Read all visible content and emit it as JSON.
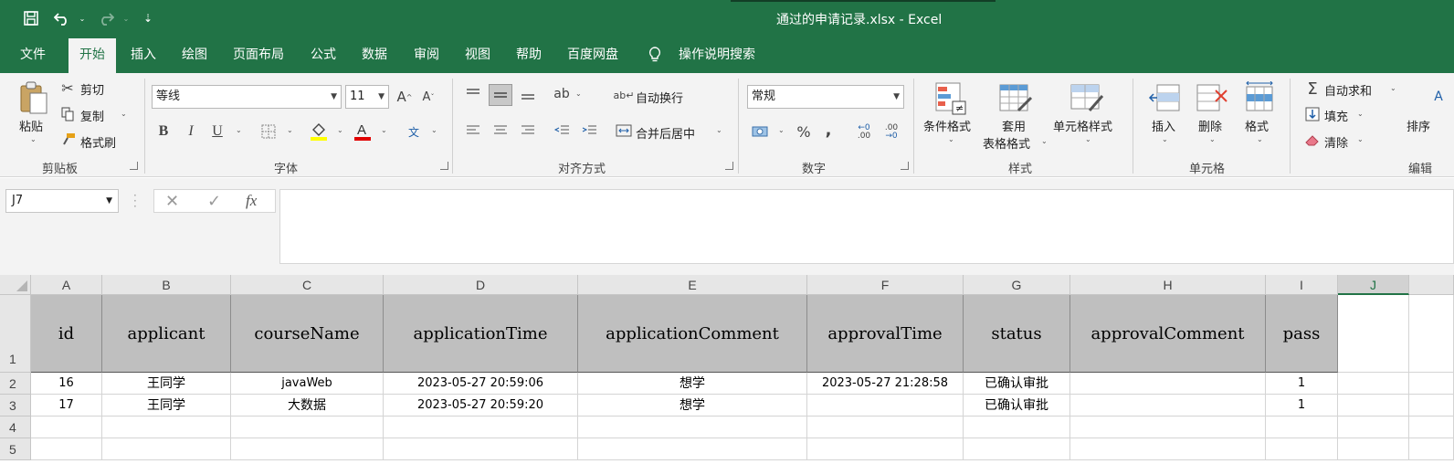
{
  "app": {
    "title": "通过的申请记录.xlsx  -  Excel",
    "accent": "#217346"
  },
  "quick_access": {
    "save_icon": "save-icon",
    "undo_icon": "undo-icon",
    "redo_icon": "redo-icon",
    "customize_icon": "customize-icon"
  },
  "tabs": [
    "文件",
    "开始",
    "插入",
    "绘图",
    "页面布局",
    "公式",
    "数据",
    "审阅",
    "视图",
    "帮助",
    "百度网盘"
  ],
  "active_tab": "开始",
  "tell_me": "操作说明搜索",
  "ribbon": {
    "clipboard": {
      "paste": "粘贴",
      "cut": "剪切",
      "copy": "复制",
      "format_painter": "格式刷",
      "label": "剪贴板"
    },
    "font": {
      "name": "等线",
      "size": "11",
      "grow": "A",
      "shrink": "A",
      "bold": "B",
      "italic": "I",
      "underline": "U",
      "label": "字体"
    },
    "alignment": {
      "wrap": "自动换行",
      "merge": "合并后居中",
      "label": "对齐方式"
    },
    "number": {
      "format": "常规",
      "percent": "%",
      "comma": ",",
      "inc_decimal": ".00",
      "dec_decimal": ".00",
      "label": "数字"
    },
    "styles": {
      "conditional": "条件格式",
      "table_line1": "套用",
      "table_line2": "表格格式",
      "cell_styles": "单元格样式",
      "label": "样式"
    },
    "cells": {
      "insert": "插入",
      "delete": "删除",
      "format": "格式",
      "label": "单元格"
    },
    "editing": {
      "autosum": "自动求和",
      "fill": "填充",
      "clear": "清除",
      "sort": "排序",
      "label": "编辑"
    }
  },
  "formula_bar": {
    "name_box": "J7",
    "fx": "fx",
    "formula": ""
  },
  "sheet": {
    "columns": [
      "A",
      "B",
      "C",
      "D",
      "E",
      "F",
      "G",
      "H",
      "I",
      "J"
    ],
    "selected_column": "J",
    "rows": [
      "1",
      "2",
      "3",
      "4",
      "5"
    ],
    "headers": [
      "id",
      "applicant",
      "courseName",
      "applicationTime",
      "applicationComment",
      "approvalTime",
      "status",
      "approvalComment",
      "pass"
    ],
    "data": [
      [
        "16",
        "王同学",
        "javaWeb",
        "2023-05-27 20:59:06",
        "想学",
        "2023-05-27 21:28:58",
        "已确认审批",
        "",
        "1"
      ],
      [
        "17",
        "王同学",
        "大数据",
        "2023-05-27 20:59:20",
        "想学",
        "",
        "已确认审批",
        "",
        "1"
      ]
    ]
  }
}
